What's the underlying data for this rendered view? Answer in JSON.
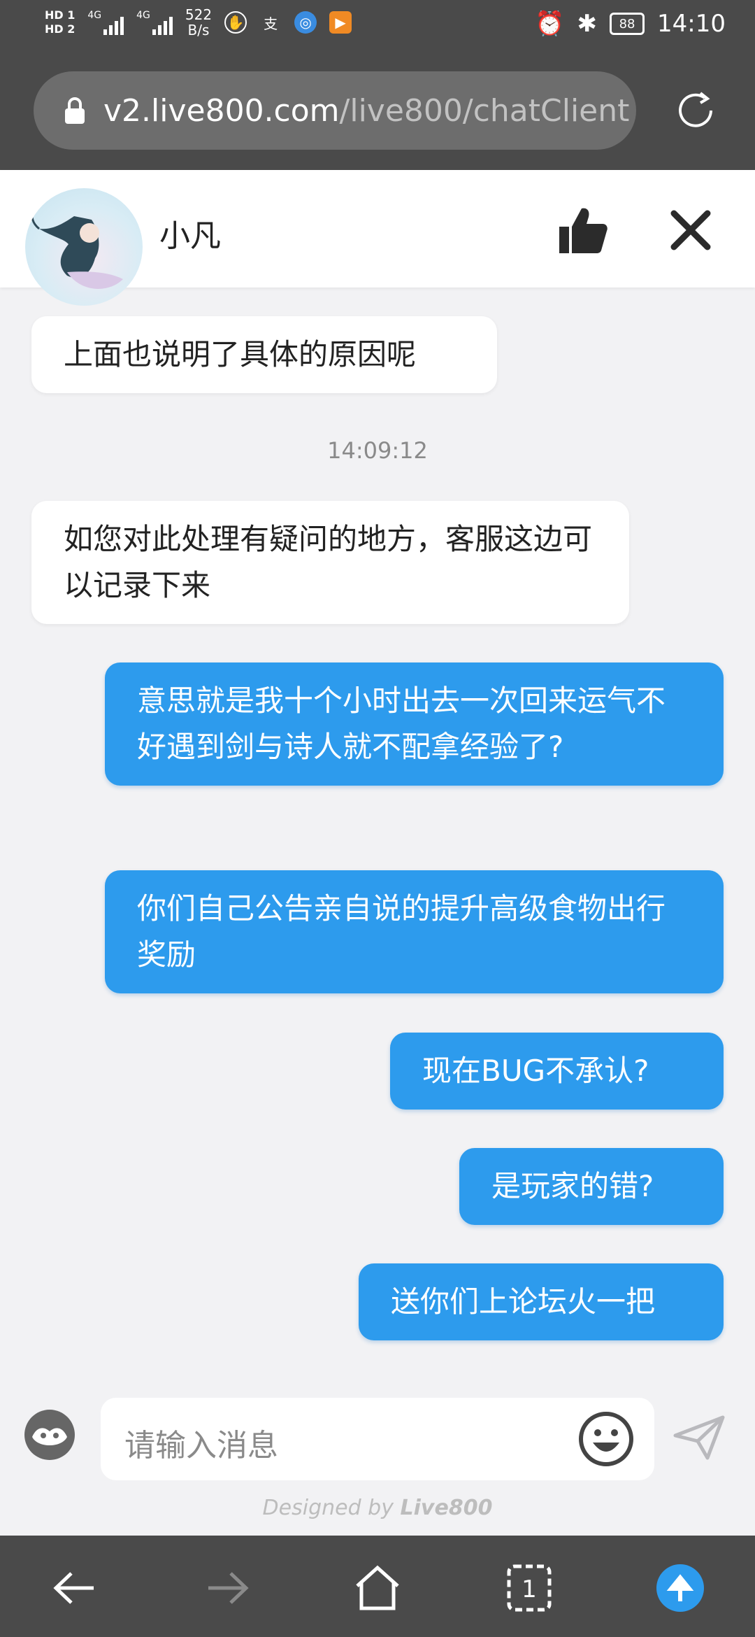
{
  "status_bar": {
    "network_label_1": "HD 1",
    "network_label_2": "HD 2",
    "net_type": "4G",
    "speed_value": "522",
    "speed_unit": "B/s",
    "battery": "88",
    "time": "14:10"
  },
  "url_bar": {
    "domain": "v2.live800.com",
    "path": "/live800/chatClient"
  },
  "chat_header": {
    "agent_name": "小凡"
  },
  "messages": [
    {
      "sender": "agent",
      "text": "上面也说明了具体的原因呢"
    },
    {
      "sender": "timestamp",
      "text": "14:09:12"
    },
    {
      "sender": "agent",
      "text": "如您对此处理有疑问的地方，客服这边可以记录下来"
    },
    {
      "sender": "user",
      "text": "意思就是我十个小时出去一次回来运气不好遇到剑与诗人就不配拿经验了?"
    },
    {
      "sender": "user",
      "text": "你们自己公告亲自说的提升高级食物出行奖励"
    },
    {
      "sender": "user",
      "text": "现在BUG不承认?"
    },
    {
      "sender": "user",
      "text": "是玩家的错?"
    },
    {
      "sender": "user",
      "text": "送你们上论坛火一把"
    }
  ],
  "input": {
    "placeholder": "请输入消息"
  },
  "credit": {
    "prefix": "Designed by",
    "brand": "Live800"
  },
  "nav_bar": {
    "tab_count": "1"
  },
  "colors": {
    "user_bubble": "#2d9bed",
    "agent_bubble": "#ffffff",
    "chrome": "#4a4a4a",
    "background": "#f2f2f4"
  }
}
